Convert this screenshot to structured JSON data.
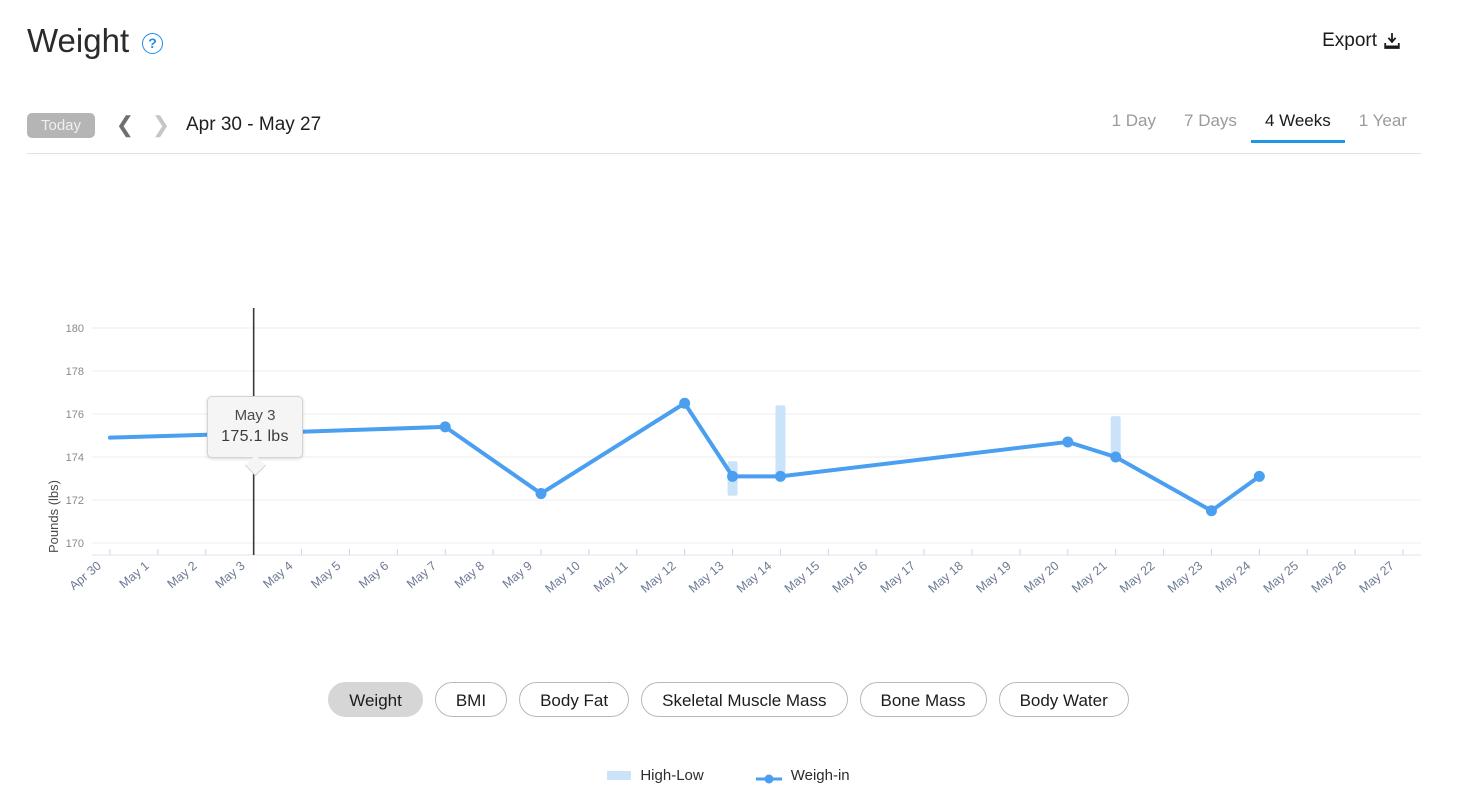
{
  "header": {
    "title": "Weight",
    "help_icon": "question-circle-icon",
    "export_label": "Export",
    "export_icon": "download-icon"
  },
  "subnav": {
    "today_label": "Today",
    "prev_icon": "chevron-left-icon",
    "next_icon": "chevron-right-icon",
    "date_range": "Apr 30 - May 27",
    "range_tabs": [
      {
        "label": "1 Day",
        "active": false
      },
      {
        "label": "7 Days",
        "active": false
      },
      {
        "label": "4 Weeks",
        "active": true
      },
      {
        "label": "1 Year",
        "active": false
      }
    ]
  },
  "tooltip": {
    "date": "May 3",
    "value": "175.1 lbs"
  },
  "legend": [
    {
      "label": "High-Low",
      "color": "#cbe3f9",
      "type": "bar"
    },
    {
      "label": "Weigh-in",
      "color": "#4a9ff0",
      "type": "line"
    }
  ],
  "metrics": [
    {
      "label": "Weight",
      "active": true
    },
    {
      "label": "BMI",
      "active": false
    },
    {
      "label": "Body Fat",
      "active": false
    },
    {
      "label": "Skeletal Muscle Mass",
      "active": false
    },
    {
      "label": "Bone Mass",
      "active": false
    },
    {
      "label": "Body Water",
      "active": false
    }
  ],
  "chart_data": {
    "type": "line",
    "title": "",
    "xlabel": "",
    "ylabel": "Pounds (lbs)",
    "ylim": [
      169.0,
      180.5
    ],
    "yticks": [
      170,
      172,
      174,
      176,
      178,
      180
    ],
    "grid": true,
    "legend_position": "bottom-center",
    "accent_color": "#4a9ff0",
    "band_color": "#cbe3f9",
    "highlight_date": "May 3",
    "x": [
      "Apr 30",
      "May 1",
      "May 2",
      "May 3",
      "May 4",
      "May 5",
      "May 6",
      "May 7",
      "May 8",
      "May 9",
      "May 10",
      "May 11",
      "May 12",
      "May 13",
      "May 14",
      "May 15",
      "May 16",
      "May 17",
      "May 18",
      "May 19",
      "May 20",
      "May 21",
      "May 22",
      "May 23",
      "May 24",
      "May 25",
      "May 26",
      "May 27"
    ],
    "series": [
      {
        "name": "Weigh-in",
        "points": [
          {
            "x": "Apr 30",
            "y": 174.9
          },
          {
            "x": "May 3",
            "y": 175.1
          },
          {
            "x": "May 7",
            "y": 175.4
          },
          {
            "x": "May 9",
            "y": 172.3
          },
          {
            "x": "May 12",
            "y": 176.5
          },
          {
            "x": "May 13",
            "y": 173.1
          },
          {
            "x": "May 14",
            "y": 173.1
          },
          {
            "x": "May 20",
            "y": 174.7
          },
          {
            "x": "May 21",
            "y": 174.0
          },
          {
            "x": "May 23",
            "y": 171.5
          },
          {
            "x": "May 24",
            "y": 173.1
          }
        ]
      },
      {
        "name": "High-Low",
        "bars": [
          {
            "x": "May 13",
            "high": 173.8,
            "low": 172.2
          },
          {
            "x": "May 14",
            "high": 176.4,
            "low": 173.1
          },
          {
            "x": "May 21",
            "high": 175.9,
            "low": 174.0
          }
        ]
      }
    ]
  }
}
